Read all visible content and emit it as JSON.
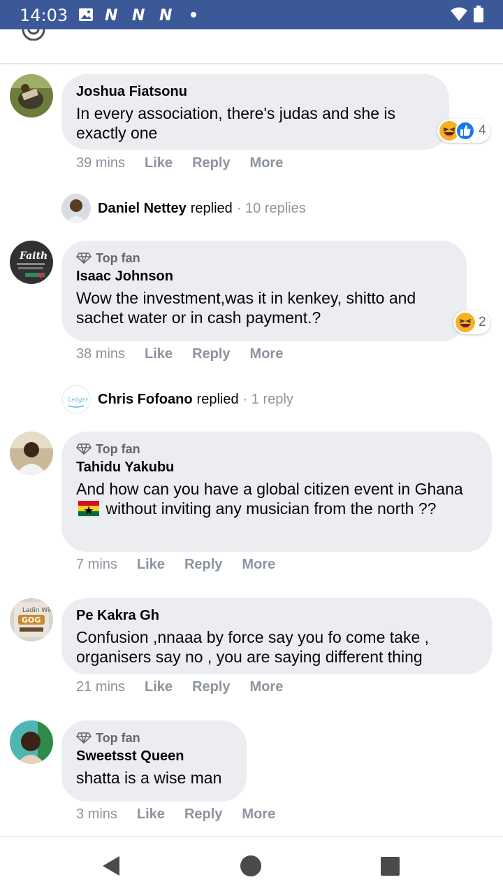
{
  "status_bar": {
    "time": "14:03",
    "app_icons": [
      "image-icon",
      "n-icon",
      "n-icon",
      "n-icon",
      "dot-icon"
    ],
    "right_icons": [
      "wifi-icon",
      "battery-icon"
    ]
  },
  "comments": [
    {
      "author": "Joshua Fiatsonu",
      "top_fan": false,
      "text": "In every association, there's judas and she is exactly one",
      "time": "39 mins",
      "actions": [
        "Like",
        "Reply",
        "More"
      ],
      "reactions": {
        "icons": [
          "haha-icon",
          "like-icon"
        ],
        "count": "4"
      },
      "replies": {
        "name": "Daniel Nettey",
        "verb": "replied",
        "count": "· 10 replies"
      }
    },
    {
      "author": "Isaac Johnson",
      "top_fan": true,
      "top_fan_label": "Top fan",
      "text": "Wow the investment,was it in kenkey, shitto and sachet water or in cash payment.?",
      "time": "38 mins",
      "actions": [
        "Like",
        "Reply",
        "More"
      ],
      "reactions": {
        "icons": [
          "haha-icon"
        ],
        "count": "2"
      },
      "replies": {
        "name": "Chris Fofoano",
        "verb": "replied",
        "count": "· 1 reply"
      }
    },
    {
      "author": "Tahidu Yakubu",
      "top_fan": true,
      "top_fan_label": "Top fan",
      "text_part1": "And how can you have a global citizen event in Ghana",
      "text_part2": "without inviting any musician from the north ??",
      "time": "7 mins",
      "actions": [
        "Like",
        "Reply",
        "More"
      ]
    },
    {
      "author": "Pe Kakra Gh",
      "top_fan": false,
      "text": "Confusion ,nnaaa by force say you fo come take , organisers say no , you are saying different thing",
      "time": "21 mins",
      "actions": [
        "Like",
        "Reply",
        "More"
      ]
    },
    {
      "author": "Sweetsst Queen",
      "top_fan": true,
      "top_fan_label": "Top fan",
      "text": "shatta is a wise man",
      "time": "3 mins",
      "actions": [
        "Like",
        "Reply",
        "More"
      ]
    }
  ],
  "nav_bar": {
    "buttons": [
      "back-icon",
      "home-icon",
      "recents-icon"
    ]
  }
}
